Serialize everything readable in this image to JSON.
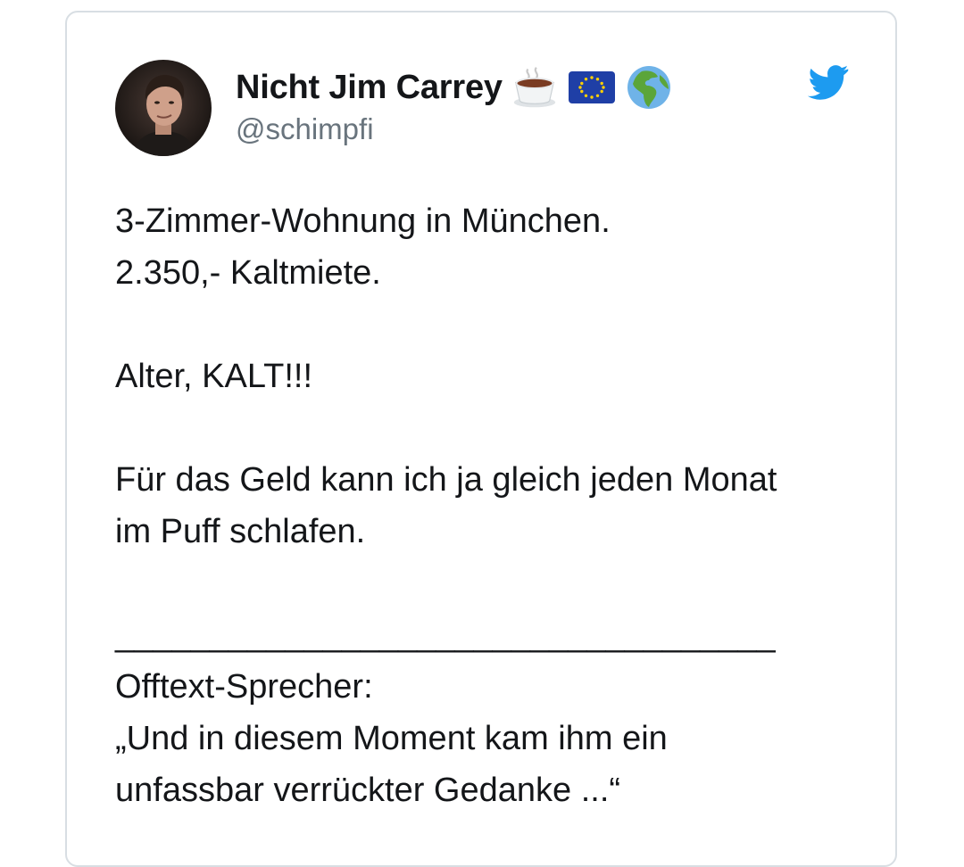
{
  "tweet": {
    "author": {
      "display_name": "Nicht Jim Carrey",
      "handle": "@schimpfi",
      "name_emojis": [
        "coffee-cup-icon",
        "eu-flag-icon",
        "globe-africa-europe-icon"
      ]
    },
    "platform_icon": "twitter-bird-icon",
    "colors": {
      "text": "#141619",
      "handle": "#69747d",
      "twitter_blue": "#1d9bf0",
      "border": "#d8dee3"
    },
    "text": {
      "line1": "3-Zimmer-Wohnung in München.",
      "line2": "2.350,- Kaltmiete.",
      "line3": "Alter, KALT!!!",
      "line4": "Für das Geld kann ich ja gleich jeden Monat",
      "line5": "im Puff schlafen.",
      "separator": "___________________________________",
      "line6": "Offtext-Sprecher:",
      "line7": "„Und in diesem Moment kam ihm ein",
      "line8": "unfassbar verrückter Gedanke ...“"
    }
  }
}
